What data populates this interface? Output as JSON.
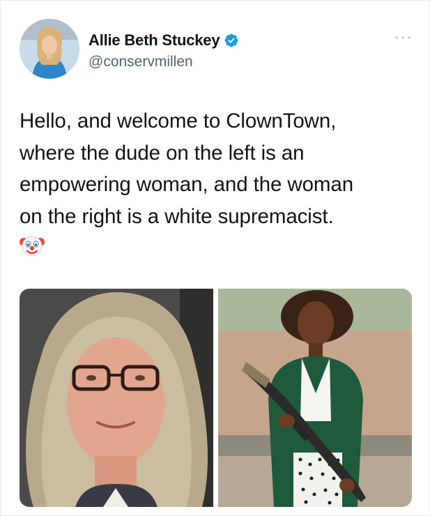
{
  "user": {
    "display_name": "Allie Beth Stuckey",
    "handle": "@conservmillen",
    "verified_icon": "verified-badge-icon",
    "verified_color": "#1d9bf0"
  },
  "tweet": {
    "line1": "Hello, and welcome to ClownTown,",
    "line2": "where the dude on the left is an",
    "line3": "empowering woman, and the woman",
    "line4": "on the right is a white supremacist.",
    "emoji": "clown-face-icon"
  },
  "colors": {
    "text": "#0f1419",
    "secondary": "#536471"
  }
}
